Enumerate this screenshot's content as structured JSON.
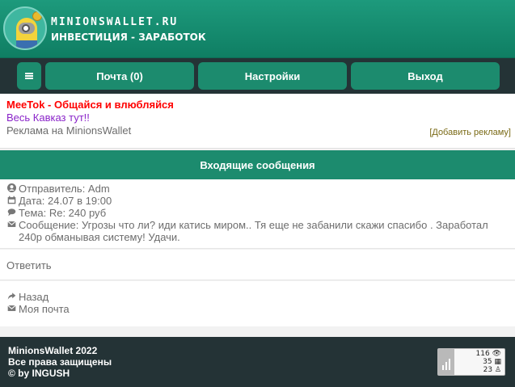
{
  "header": {
    "site_name": "MINIONSWALLET.RU",
    "subtitle": "ИНВЕСТИЦИЯ - ЗАРАБОТОК"
  },
  "nav": {
    "menu_icon": "hamburger-icon",
    "mail_label": "Почта (0)",
    "settings_label": "Настройки",
    "logout_label": "Выход"
  },
  "ads": {
    "ad1": "MeeTok - Общайся и влюбляйся",
    "ad2": "Весь Кавказ тут!!",
    "ad3": "Реклама на MinionsWallet",
    "add_link": "[Добавить рекламу]"
  },
  "section_title": "Входящие сообщения",
  "message": {
    "sender": "Отправитель: Adm",
    "date": "Дата: 24.07 в 19:00",
    "subject": "Тема: Re: 240 руб",
    "body": "Сообщение: Угрозы что ли? иди катись миром.. Тя еще не забанили скажи спасибо . Заработал 240р обманывая систему! Удачи."
  },
  "reply_label": "Ответить",
  "links": {
    "back": "Назад",
    "my_mail": "Моя почта"
  },
  "footer": {
    "line1": "MinionsWallet 2022",
    "line2": "Все права защищены",
    "line3": "© by INGUSH"
  },
  "counter": {
    "views": "116",
    "visits": "35",
    "users": "23"
  },
  "colors": {
    "header_green": "#1d9a7c",
    "button_green": "#1c8b6e",
    "dark_bar": "#243336",
    "ad_red": "#ff0000",
    "ad_purple": "#8a24c9"
  }
}
